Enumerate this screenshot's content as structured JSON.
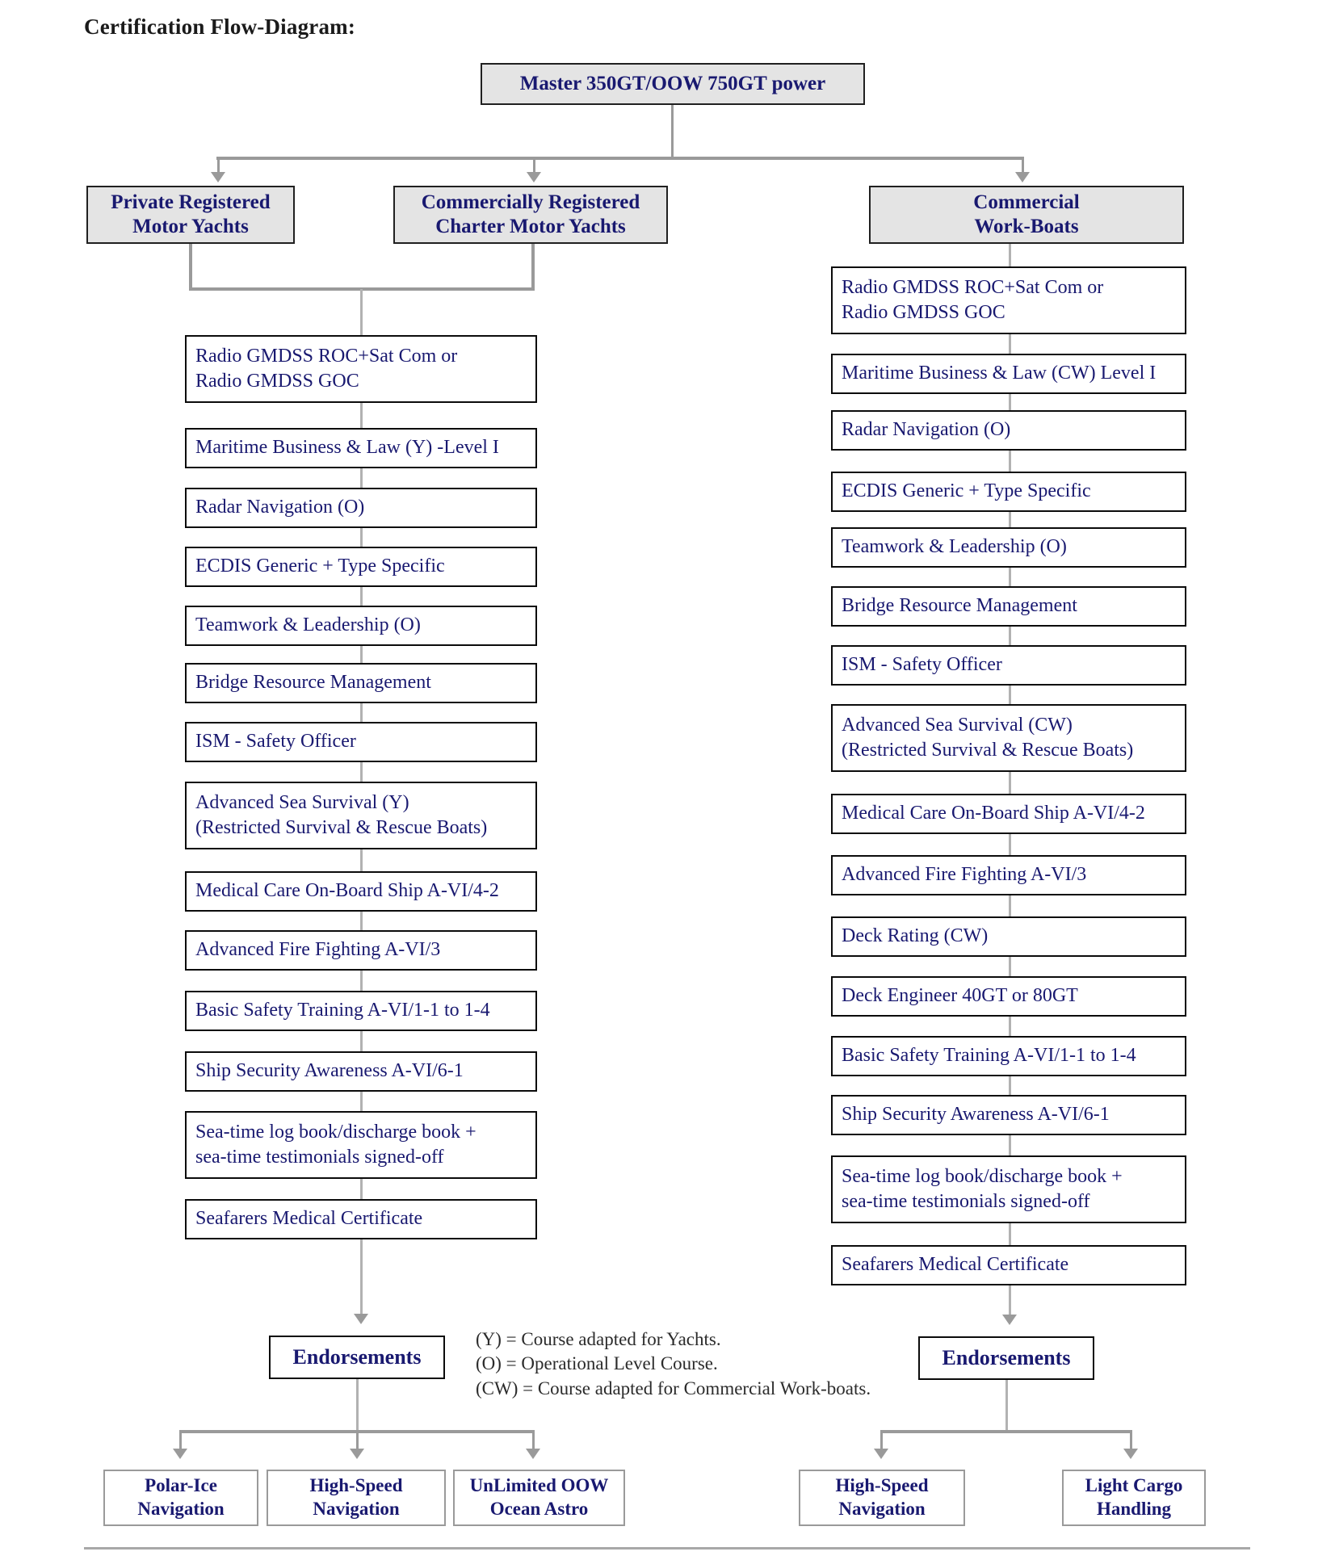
{
  "title": "Certification Flow-Diagram:",
  "colors": {
    "box_text": "#191970",
    "header_fill": "#e4e4e4",
    "connector": "#9a9a9a",
    "title_text": "#1a1a1a"
  },
  "root": {
    "label": "Master 350GT/OOW 750GT power"
  },
  "categories": [
    {
      "line1": "Private Registered",
      "line2": "Motor Yachts"
    },
    {
      "line1": "Commercially Registered",
      "line2": "Charter Motor Yachts"
    },
    {
      "line1": "Commercial",
      "line2": "Work-Boats"
    }
  ],
  "yacht_column": {
    "items": [
      {
        "line1": "Radio GMDSS ROC+Sat Com or",
        "line2": "Radio GMDSS GOC"
      },
      {
        "line1": "Maritime Business & Law (Y) -Level I",
        "line2": ""
      },
      {
        "line1": "Radar Navigation (O)",
        "line2": ""
      },
      {
        "line1": "ECDIS Generic + Type Specific",
        "line2": ""
      },
      {
        "line1": "Teamwork & Leadership  (O)",
        "line2": ""
      },
      {
        "line1": "Bridge Resource Management",
        "line2": ""
      },
      {
        "line1": "ISM - Safety Officer",
        "line2": ""
      },
      {
        "line1": "Advanced Sea Survival (Y)",
        "line2": "(Restricted Survival & Rescue Boats)"
      },
      {
        "line1": "Medical Care On-Board Ship A-VI/4-2",
        "line2": ""
      },
      {
        "line1": "Advanced Fire Fighting A-VI/3",
        "line2": ""
      },
      {
        "line1": "Basic Safety Training  A-VI/1-1 to 1-4",
        "line2": ""
      },
      {
        "line1": "Ship Security Awareness A-VI/6-1",
        "line2": ""
      },
      {
        "line1": "Sea-time log book/discharge book +",
        "line2": "sea-time testimonials signed-off"
      },
      {
        "line1": "Seafarers Medical Certificate",
        "line2": ""
      }
    ],
    "endorsements_label": "Endorsements",
    "endorsements": [
      {
        "line1": "Polar-Ice",
        "line2": "Navigation"
      },
      {
        "line1": "High-Speed",
        "line2": "Navigation"
      },
      {
        "line1": "UnLimited OOW",
        "line2": "Ocean Astro"
      }
    ]
  },
  "workboat_column": {
    "items": [
      {
        "line1": "Radio GMDSS ROC+Sat Com or",
        "line2": "Radio GMDSS GOC"
      },
      {
        "line1": "Maritime Business & Law (CW) Level I",
        "line2": ""
      },
      {
        "line1": "Radar Navigation (O)",
        "line2": ""
      },
      {
        "line1": "ECDIS Generic + Type Specific",
        "line2": ""
      },
      {
        "line1": "Teamwork & Leadership (O)",
        "line2": ""
      },
      {
        "line1": "Bridge Resource Management",
        "line2": ""
      },
      {
        "line1": "ISM - Safety Officer",
        "line2": ""
      },
      {
        "line1": "Advanced Sea Survival (CW)",
        "line2": "(Restricted Survival & Rescue Boats)"
      },
      {
        "line1": "Medical Care On-Board Ship A-VI/4-2",
        "line2": ""
      },
      {
        "line1": "Advanced Fire Fighting A-VI/3",
        "line2": ""
      },
      {
        "line1": "Deck Rating (CW)",
        "line2": ""
      },
      {
        "line1": "Deck Engineer 40GT or 80GT",
        "line2": ""
      },
      {
        "line1": "Basic Safety Training  A-VI/1-1 to 1-4",
        "line2": ""
      },
      {
        "line1": "Ship Security Awareness A-VI/6-1",
        "line2": ""
      },
      {
        "line1": "Sea-time log book/discharge book +",
        "line2": "sea-time testimonials signed-off"
      },
      {
        "line1": "Seafarers Medical Certificate",
        "line2": ""
      }
    ],
    "endorsements_label": "Endorsements",
    "endorsements": [
      {
        "line1": "High-Speed",
        "line2": "Navigation"
      },
      {
        "line1": "Light Cargo",
        "line2": "Handling"
      }
    ]
  },
  "legend": {
    "line1": "(Y) = Course adapted for Yachts.",
    "line2": "(O) = Operational Level Course.",
    "line3": "(CW) = Course adapted for Commercial Work-boats."
  }
}
